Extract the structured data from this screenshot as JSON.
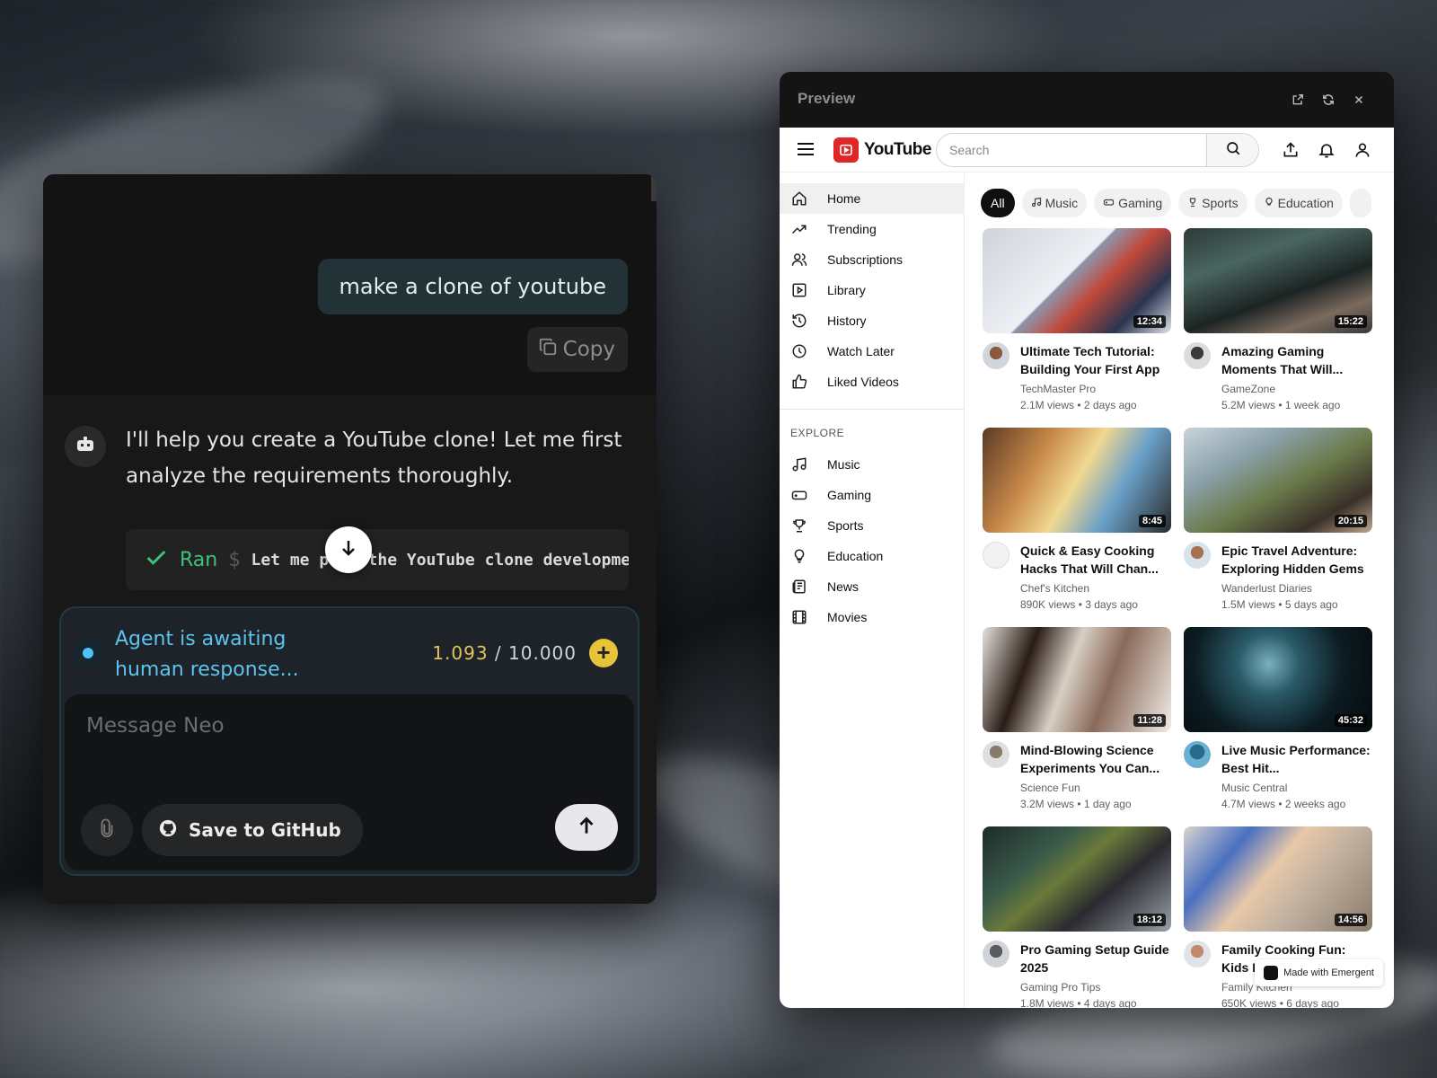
{
  "chat": {
    "user_message": "make a clone of youtube",
    "copy_label": "Copy",
    "bot_message": "I'll help you create a YouTube clone! Let me first analyze the requirements thoroughly.",
    "ran_label": "Ran",
    "ran_dollar": "$",
    "ran_command": "Let me plan the YouTube clone development",
    "status_text": "Agent is awaiting human response...",
    "credits_used": "1.093",
    "credits_sep": " / ",
    "credits_total": "10.000",
    "message_placeholder": "Message Neo",
    "github_label": "Save to GitHub"
  },
  "preview": {
    "title": "Preview",
    "icons": [
      "external-link-icon",
      "refresh-icon",
      "close-icon"
    ]
  },
  "youtube": {
    "logo_text": "YouTube",
    "search_placeholder": "Search",
    "sidebar": [
      {
        "label": "Home",
        "icon": "home-icon"
      },
      {
        "label": "Trending",
        "icon": "trending-icon"
      },
      {
        "label": "Subscriptions",
        "icon": "subscriptions-icon"
      },
      {
        "label": "Library",
        "icon": "library-icon"
      },
      {
        "label": "History",
        "icon": "history-icon"
      },
      {
        "label": "Watch Later",
        "icon": "clock-icon"
      },
      {
        "label": "Liked Videos",
        "icon": "thumbs-up-icon"
      }
    ],
    "explore_heading": "EXPLORE",
    "explore": [
      {
        "label": "Music",
        "icon": "music-icon"
      },
      {
        "label": "Gaming",
        "icon": "gamepad-icon"
      },
      {
        "label": "Sports",
        "icon": "trophy-icon"
      },
      {
        "label": "Education",
        "icon": "lightbulb-icon"
      },
      {
        "label": "News",
        "icon": "newspaper-icon"
      },
      {
        "label": "Movies",
        "icon": "film-icon"
      }
    ],
    "chips": [
      "All",
      "Music",
      "Gaming",
      "Sports",
      "Education"
    ],
    "videos": [
      {
        "title": "Ultimate Tech Tutorial: Building Your First App",
        "channel": "TechMaster Pro",
        "meta": "2.1M views • 2 days ago",
        "duration": "12:34"
      },
      {
        "title": "Amazing Gaming Moments That Will...",
        "channel": "GameZone",
        "meta": "5.2M views • 1 week ago",
        "duration": "15:22"
      },
      {
        "title": "Quick & Easy Cooking Hacks That Will Chan...",
        "channel": "Chef's Kitchen",
        "meta": "890K views • 3 days ago",
        "duration": "8:45"
      },
      {
        "title": "Epic Travel Adventure: Exploring Hidden Gems",
        "channel": "Wanderlust Diaries",
        "meta": "1.5M views • 5 days ago",
        "duration": "20:15"
      },
      {
        "title": "Mind-Blowing Science Experiments You Can...",
        "channel": "Science Fun",
        "meta": "3.2M views • 1 day ago",
        "duration": "11:28"
      },
      {
        "title": "Live Music Performance: Best Hit...",
        "channel": "Music Central",
        "meta": "4.7M views • 2 weeks ago",
        "duration": "45:32"
      },
      {
        "title": "Pro Gaming Setup Guide 2025",
        "channel": "Gaming Pro Tips",
        "meta": "1.8M views • 4 days ago",
        "duration": "18:12"
      },
      {
        "title": "Family Cooking Fun: Kids Kitchen",
        "channel": "Family Kitchen",
        "meta": "650K views • 6 days ago",
        "duration": "14:56"
      }
    ],
    "badge": "Made with Emergent"
  }
}
